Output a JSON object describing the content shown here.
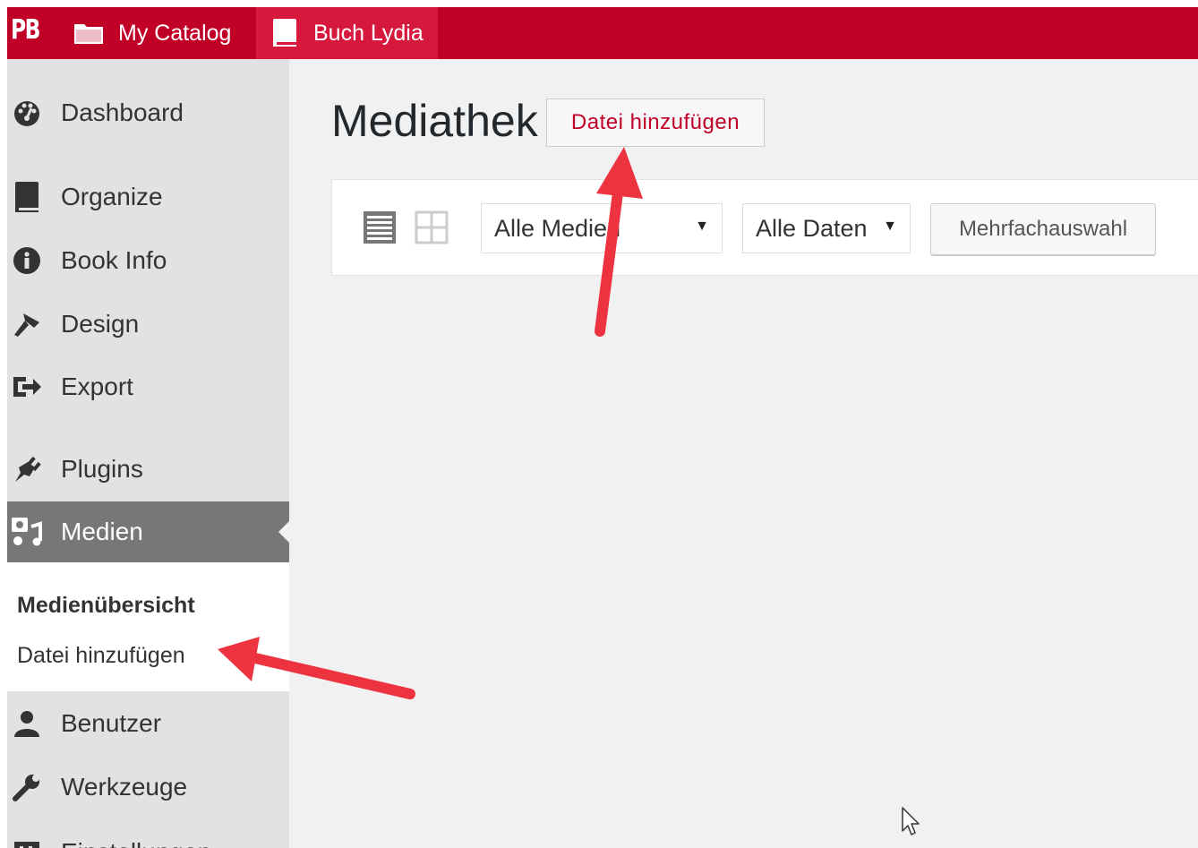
{
  "admin_bar": {
    "logo": "PB",
    "catalog_label": "My Catalog",
    "book_label": "Buch Lydia"
  },
  "sidebar": {
    "items": [
      {
        "label": "Dashboard",
        "icon": "dashboard-icon"
      },
      {
        "label": "Organize",
        "icon": "book-icon"
      },
      {
        "label": "Book Info",
        "icon": "info-icon"
      },
      {
        "label": "Design",
        "icon": "brush-icon"
      },
      {
        "label": "Export",
        "icon": "export-icon"
      },
      {
        "label": "Plugins",
        "icon": "plugin-icon"
      },
      {
        "label": "Medien",
        "icon": "media-icon"
      },
      {
        "label": "Benutzer",
        "icon": "user-icon"
      },
      {
        "label": "Werkzeuge",
        "icon": "wrench-icon"
      },
      {
        "label": "Einstellungen",
        "icon": "settings-icon"
      }
    ],
    "submenu": {
      "overview": "Medienübersicht",
      "add_file": "Datei hinzufügen"
    }
  },
  "main": {
    "title": "Mediathek",
    "add_button": "Datei hinzufügen",
    "filter_type": "Alle Medien",
    "filter_date": "Alle Daten",
    "bulk_select": "Mehrfachauswahl"
  },
  "colors": {
    "brand": "#c00027",
    "active_menu": "#777777",
    "annotation_arrow": "#ee3340"
  }
}
